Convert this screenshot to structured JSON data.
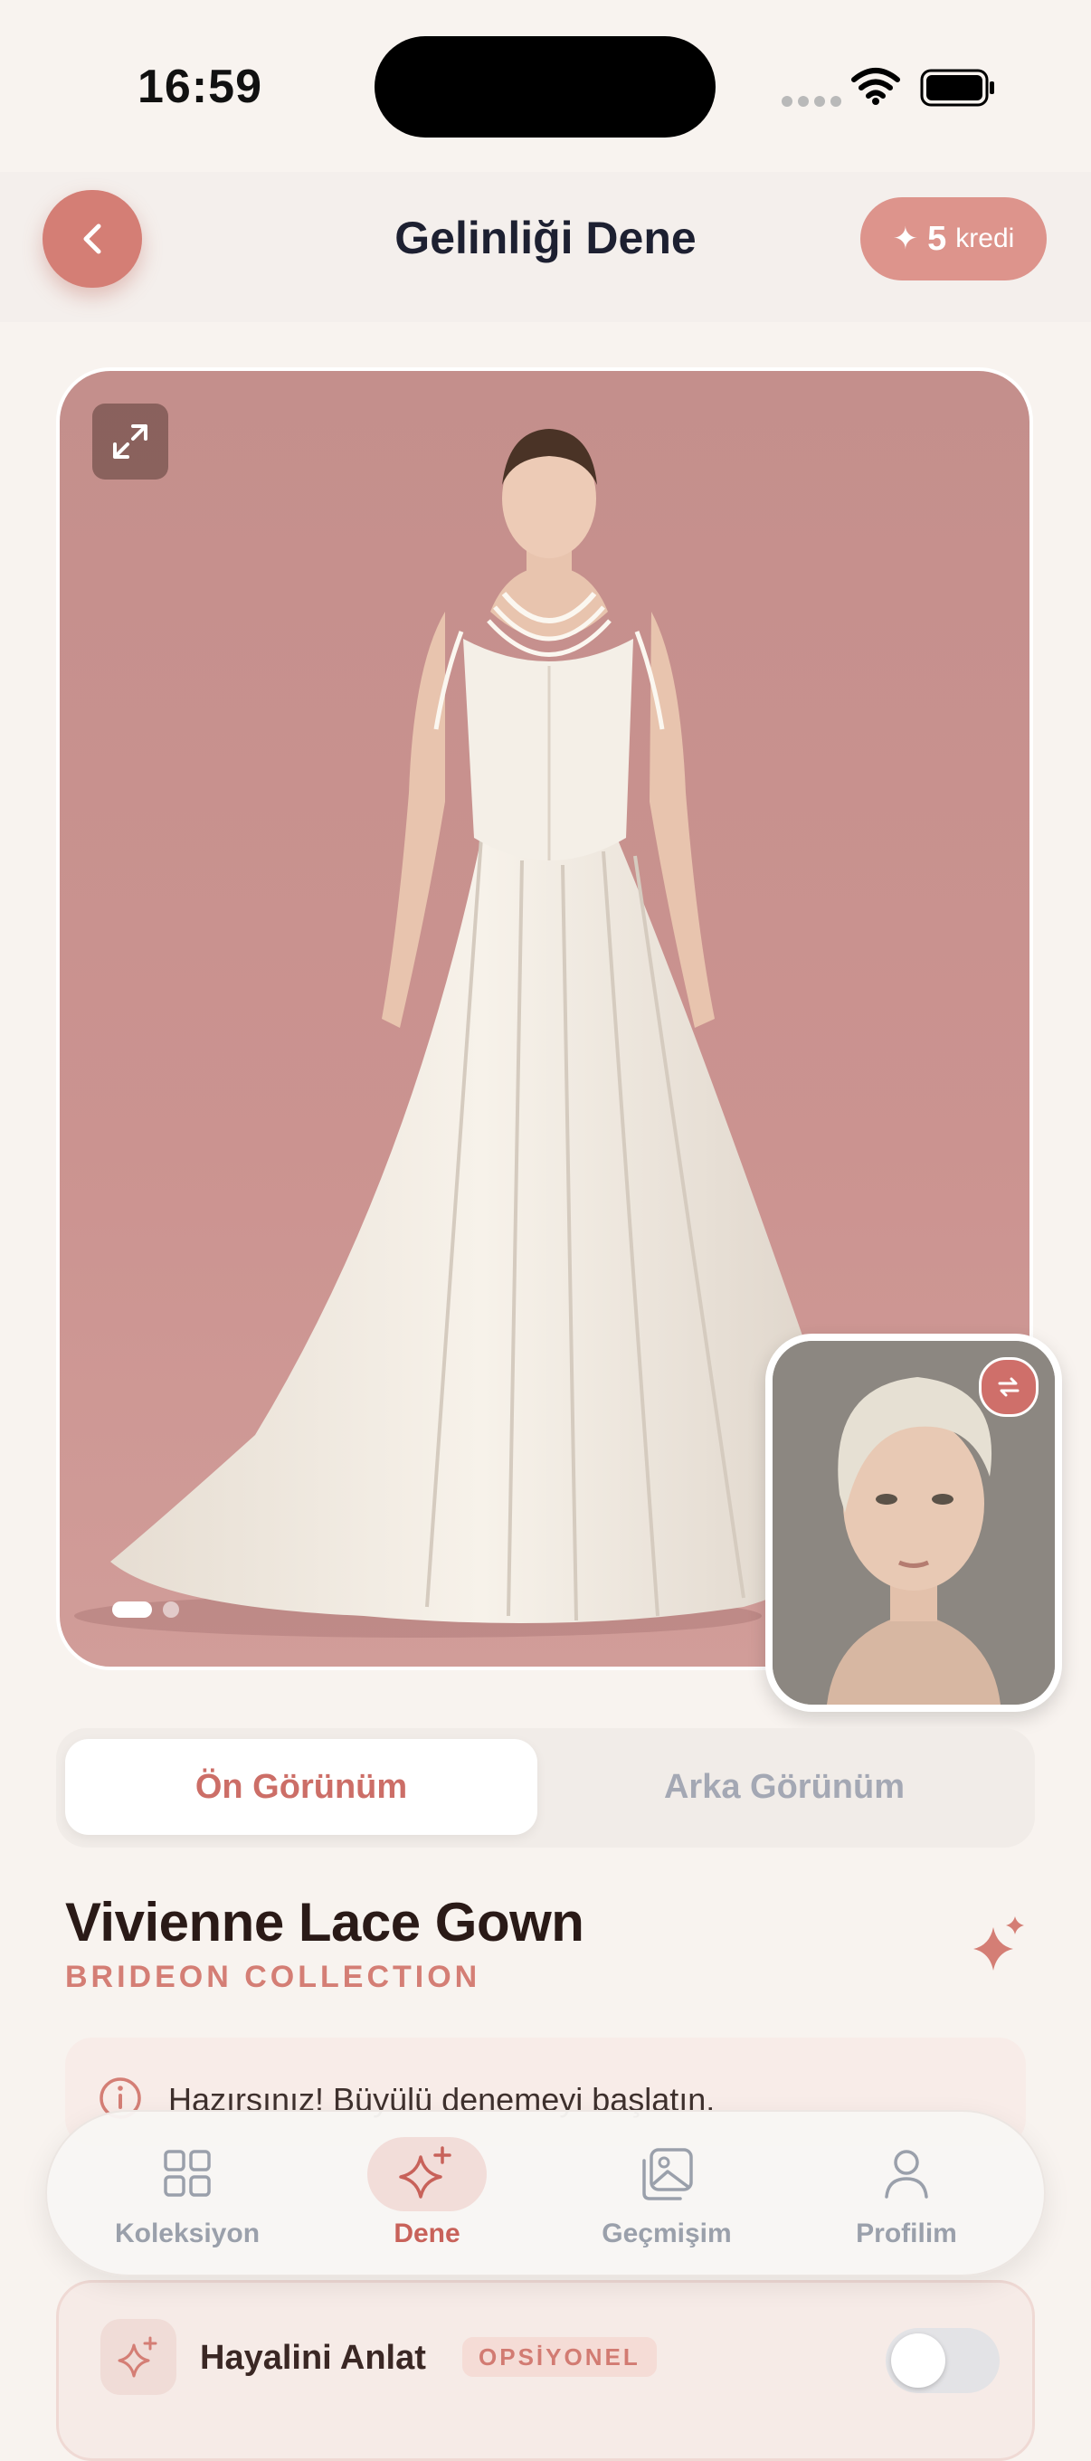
{
  "status": {
    "time": "16:59"
  },
  "header": {
    "title": "Gelinliği Dene",
    "credits_count": "5",
    "credits_label": "kredi"
  },
  "preview": {
    "image_count": 2,
    "active_index": 0
  },
  "view_toggle": {
    "front": "Ön Görünüm",
    "back": "Arka Görünüm",
    "selected": "front"
  },
  "gown": {
    "name": "Vivienne Lace Gown",
    "collection": "BRIDEON COLLECTION"
  },
  "info": {
    "message": "Hazırsınız! Büyülü denemeyi başlatın."
  },
  "dream": {
    "title": "Hayalini Anlat",
    "badge": "OPSİYONEL",
    "enabled": false
  },
  "tabs": [
    {
      "label": "Koleksiyon",
      "icon": "grid-icon",
      "active": false
    },
    {
      "label": "Dene",
      "icon": "sparkle-icon",
      "active": true
    },
    {
      "label": "Geçmişim",
      "icon": "gallery-icon",
      "active": false
    },
    {
      "label": "Profilim",
      "icon": "user-icon",
      "active": false
    }
  ],
  "colors": {
    "accent": "#d47e75",
    "background": "#f8f3ef",
    "preview_bg": "#c99290"
  }
}
